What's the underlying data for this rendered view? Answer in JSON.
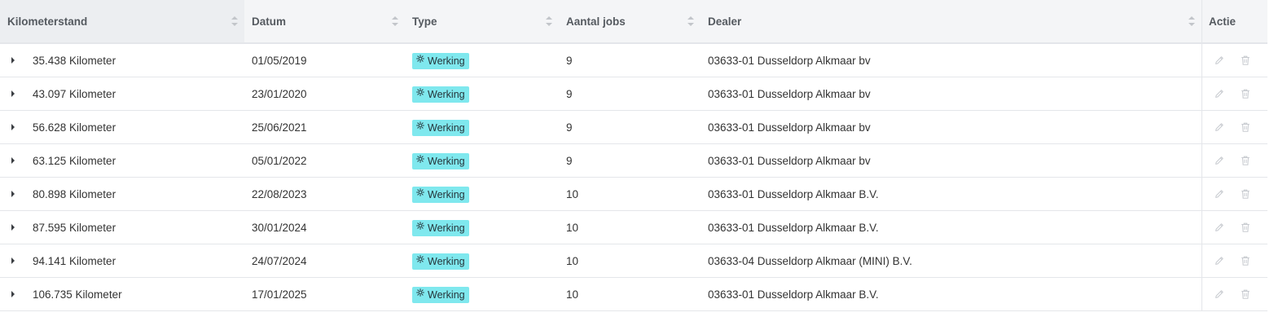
{
  "table": {
    "headers": [
      "Kilometerstand",
      "Datum",
      "Type",
      "Aantal jobs",
      "Dealer",
      "Actie"
    ],
    "rows": [
      {
        "km": "35.438 Kilometer",
        "date": "01/05/2019",
        "type": "Werking",
        "jobs": "9",
        "dealer": "03633-01 Dusseldorp Alkmaar bv"
      },
      {
        "km": "43.097 Kilometer",
        "date": "23/01/2020",
        "type": "Werking",
        "jobs": "9",
        "dealer": "03633-01 Dusseldorp Alkmaar bv"
      },
      {
        "km": "56.628 Kilometer",
        "date": "25/06/2021",
        "type": "Werking",
        "jobs": "9",
        "dealer": "03633-01 Dusseldorp Alkmaar bv"
      },
      {
        "km": "63.125 Kilometer",
        "date": "05/01/2022",
        "type": "Werking",
        "jobs": "9",
        "dealer": "03633-01 Dusseldorp Alkmaar bv"
      },
      {
        "km": "80.898 Kilometer",
        "date": "22/08/2023",
        "type": "Werking",
        "jobs": "10",
        "dealer": "03633-01 Dusseldorp Alkmaar B.V."
      },
      {
        "km": "87.595 Kilometer",
        "date": "30/01/2024",
        "type": "Werking",
        "jobs": "10",
        "dealer": "03633-01 Dusseldorp Alkmaar B.V."
      },
      {
        "km": "94.141 Kilometer",
        "date": "24/07/2024",
        "type": "Werking",
        "jobs": "10",
        "dealer": "03633-04 Dusseldorp Alkmaar (MINI) B.V."
      },
      {
        "km": "106.735 Kilometer",
        "date": "17/01/2025",
        "type": "Werking",
        "jobs": "10",
        "dealer": "03633-01 Dusseldorp Alkmaar B.V."
      }
    ],
    "row_icons": {
      "expand": "caret-right-icon",
      "type": "gear-icon",
      "edit": "pencil-icon",
      "delete": "trash-icon"
    },
    "colors": {
      "badge_bg": "#7fe8ee",
      "header_bg": "#f4f5f7",
      "border": "#e4e6ea",
      "action_icon": "#c8cbd0"
    }
  }
}
